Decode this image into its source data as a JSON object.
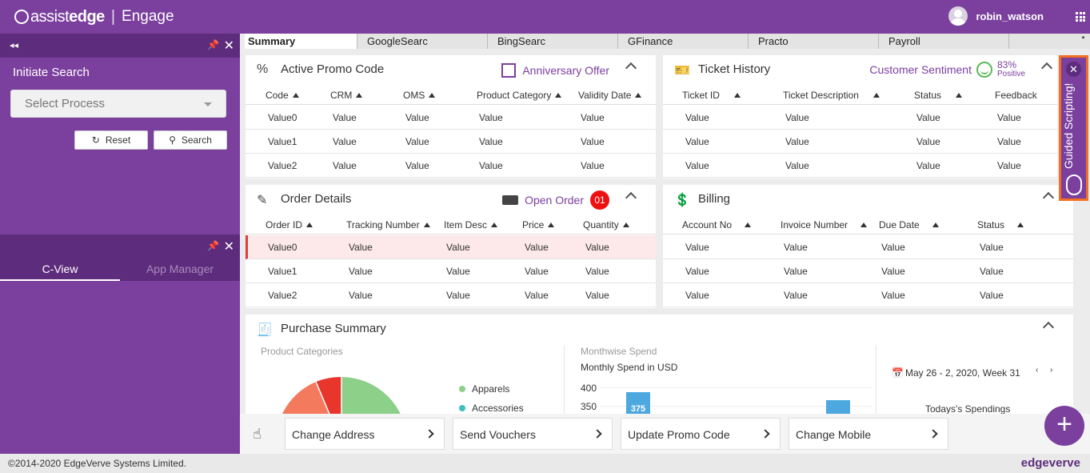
{
  "header": {
    "brand_light": "assist",
    "brand_bold": "edge",
    "brand_sep": "|",
    "product": "Engage",
    "username": "robin_watson"
  },
  "left_panel": {
    "title": "Initiate Search",
    "process_placeholder": "Select Process",
    "reset_label": "Reset",
    "search_label": "Search",
    "tabs": [
      "C-View",
      "App Manager"
    ]
  },
  "tabs": [
    "Summary",
    "GoogleSearc",
    "BingSearc",
    "GFinance",
    "Practo",
    "Payroll"
  ],
  "promo": {
    "title": "Active Promo Code",
    "offer": "Anniversary Offer",
    "columns": [
      "Code",
      "CRM",
      "OMS",
      "Product Category",
      "Validity Date"
    ],
    "rows": [
      [
        "Value0",
        "Value",
        "Value",
        "Value",
        "Value"
      ],
      [
        "Value1",
        "Value",
        "Value",
        "Value",
        "Value"
      ],
      [
        "Value2",
        "Value",
        "Value",
        "Value",
        "Value"
      ]
    ]
  },
  "ticket": {
    "title": "Ticket History",
    "sentiment_label": "Customer Sentiment",
    "sentiment_pct": "83%",
    "sentiment_text": "Positive",
    "columns": [
      "Ticket ID",
      "Ticket Description",
      "Status",
      "Feedback"
    ],
    "rows": [
      [
        "Value",
        "Value",
        "Value",
        "Value"
      ],
      [
        "Value",
        "Value",
        "Value",
        "Value"
      ],
      [
        "Value",
        "Value",
        "Value",
        "Value"
      ]
    ]
  },
  "order": {
    "title": "Order Details",
    "open_label": "Open Order",
    "open_count": "01",
    "columns": [
      "Order ID",
      "Tracking Number",
      "Item Desc",
      "Price",
      "Quantity"
    ],
    "rows": [
      [
        "Value0",
        "Value",
        "Value",
        "Value",
        "Value"
      ],
      [
        "Value1",
        "Value",
        "Value",
        "Value",
        "Value"
      ],
      [
        "Value2",
        "Value",
        "Value",
        "Value",
        "Value"
      ]
    ]
  },
  "billing": {
    "title": "Billing",
    "columns": [
      "Account No",
      "Invoice Number",
      "Due Date",
      "Status"
    ],
    "rows": [
      [
        "Value",
        "Value",
        "Value",
        "Value"
      ],
      [
        "Value",
        "Value",
        "Value",
        "Value"
      ],
      [
        "Value",
        "Value",
        "Value",
        "Value"
      ]
    ]
  },
  "purchase": {
    "title": "Purchase Summary",
    "categories_label": "Product Categories",
    "legend": [
      "Apparels",
      "Accessories"
    ],
    "legend_colors": [
      "#8dd08a",
      "#3dbfc1"
    ],
    "monthwise_label": "Monthwise Spend",
    "monthly_label": "Monthly Spend in USD",
    "y_ticks": [
      "400",
      "350"
    ],
    "bar_value": "375",
    "date_range": "May 26 - 2, 2020, Week 31",
    "todays": "Todays's Spendings"
  },
  "guided": {
    "label": "Guided Scripting!"
  },
  "actions": [
    "Change Address",
    "Send Vouchers",
    "Update Promo Code",
    "Change Mobile"
  ],
  "footer": {
    "copyright": "©2014-2020 EdgeVerve Systems Limited.",
    "logo_a": "edge",
    "logo_b": "verve"
  }
}
